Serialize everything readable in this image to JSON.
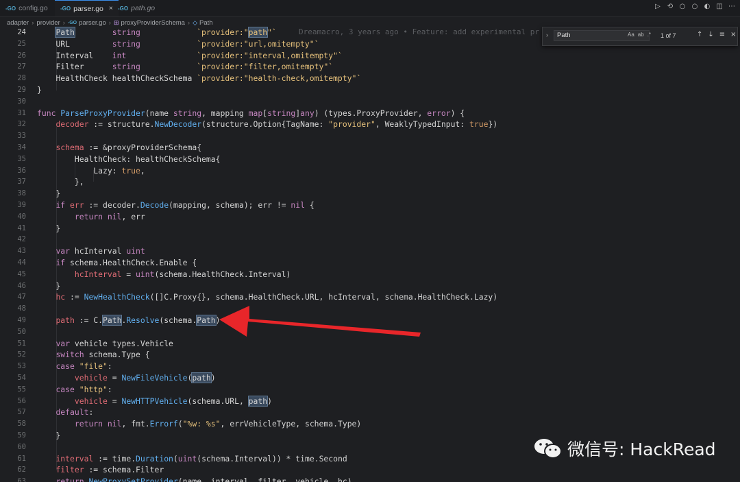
{
  "tabs": [
    {
      "label": "config.go",
      "active": false,
      "italic": false
    },
    {
      "label": "parser.go",
      "active": true,
      "italic": false,
      "close": "×"
    },
    {
      "label": "path.go",
      "active": false,
      "italic": true
    }
  ],
  "go_badge": "-GO",
  "toolbar_icons": [
    "run-icon",
    "debug-icon",
    "circle-icon",
    "circle-icon-2",
    "compare-icon",
    "split-editor-icon",
    "more-icon"
  ],
  "breadcrumb": [
    "adapter",
    "provider",
    "parser.go",
    "proxyProviderSchema",
    "Path"
  ],
  "find_widget": {
    "query": "Path",
    "match_case": "Aa",
    "whole_word": "ab",
    "regex": ".*",
    "count": "1 of 7"
  },
  "blame": "Dreamacro, 3 years ago • Feature: add experimental pr",
  "watermark": "微信号: HackRead",
  "colors": {
    "accent": "#3b8eea",
    "arrow": "#e8262a"
  },
  "lines": [
    {
      "n": "24",
      "code": "    Path        string            `provider:\"path\"`"
    },
    {
      "n": "25",
      "code": "    URL         string            `provider:\"url,omitempty\"`"
    },
    {
      "n": "26",
      "code": "    Interval    int               `provider:\"interval,omitempty\"`"
    },
    {
      "n": "27",
      "code": "    Filter      string            `provider:\"filter,omitempty\"`"
    },
    {
      "n": "28",
      "code": "    HealthCheck healthCheckSchema `provider:\"health-check,omitempty\"`"
    },
    {
      "n": "29",
      "code": "}"
    },
    {
      "n": "30",
      "code": ""
    },
    {
      "n": "31",
      "code": "func ParseProxyProvider(name string, mapping map[string]any) (types.ProxyProvider, error) {"
    },
    {
      "n": "32",
      "code": "    decoder := structure.NewDecoder(structure.Option{TagName: \"provider\", WeaklyTypedInput: true})"
    },
    {
      "n": "33",
      "code": ""
    },
    {
      "n": "34",
      "code": "    schema := &proxyProviderSchema{"
    },
    {
      "n": "35",
      "code": "        HealthCheck: healthCheckSchema{"
    },
    {
      "n": "36",
      "code": "            Lazy: true,"
    },
    {
      "n": "37",
      "code": "        },"
    },
    {
      "n": "38",
      "code": "    }"
    },
    {
      "n": "39",
      "code": "    if err := decoder.Decode(mapping, schema); err != nil {"
    },
    {
      "n": "40",
      "code": "        return nil, err"
    },
    {
      "n": "41",
      "code": "    }"
    },
    {
      "n": "42",
      "code": ""
    },
    {
      "n": "43",
      "code": "    var hcInterval uint"
    },
    {
      "n": "44",
      "code": "    if schema.HealthCheck.Enable {"
    },
    {
      "n": "45",
      "code": "        hcInterval = uint(schema.HealthCheck.Interval)"
    },
    {
      "n": "46",
      "code": "    }"
    },
    {
      "n": "47",
      "code": "    hc := NewHealthCheck([]C.Proxy{}, schema.HealthCheck.URL, hcInterval, schema.HealthCheck.Lazy)"
    },
    {
      "n": "48",
      "code": ""
    },
    {
      "n": "49",
      "code": "    path := C.Path.Resolve(schema.Path)"
    },
    {
      "n": "50",
      "code": ""
    },
    {
      "n": "51",
      "code": "    var vehicle types.Vehicle"
    },
    {
      "n": "52",
      "code": "    switch schema.Type {"
    },
    {
      "n": "53",
      "code": "    case \"file\":"
    },
    {
      "n": "54",
      "code": "        vehicle = NewFileVehicle(path)"
    },
    {
      "n": "55",
      "code": "    case \"http\":"
    },
    {
      "n": "56",
      "code": "        vehicle = NewHTTPVehicle(schema.URL, path)"
    },
    {
      "n": "57",
      "code": "    default:"
    },
    {
      "n": "58",
      "code": "        return nil, fmt.Errorf(\"%w: %s\", errVehicleType, schema.Type)"
    },
    {
      "n": "59",
      "code": "    }"
    },
    {
      "n": "60",
      "code": ""
    },
    {
      "n": "61",
      "code": "    interval := time.Duration(uint(schema.Interval)) * time.Second"
    },
    {
      "n": "62",
      "code": "    filter := schema.Filter"
    },
    {
      "n": "63",
      "code": "    return NewProxySetProvider(name, interval, filter, vehicle, hc)"
    }
  ]
}
